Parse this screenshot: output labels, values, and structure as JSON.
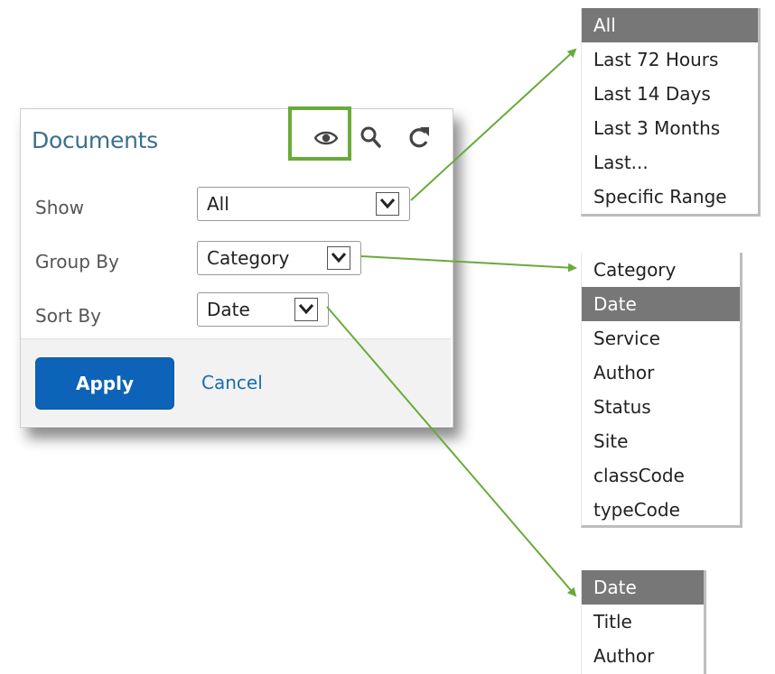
{
  "panel": {
    "title": "Documents",
    "icons": [
      "eye-icon",
      "search-icon",
      "refresh-icon"
    ],
    "highlight_color": "#6aaa3a",
    "show": {
      "label": "Show",
      "value": "All"
    },
    "group_by": {
      "label": "Group By",
      "value": "Category"
    },
    "sort_by": {
      "label": "Sort By",
      "value": "Date"
    },
    "apply_label": "Apply",
    "cancel_label": "Cancel",
    "accent_color": "#0c63b8"
  },
  "show_options": {
    "items": [
      "All",
      "Last 72 Hours",
      "Last 14 Days",
      "Last 3 Months",
      "Last...",
      "Specific Range"
    ],
    "selected": "All"
  },
  "group_by_options": {
    "items": [
      "Category",
      "Date",
      "Service",
      "Author",
      "Status",
      "Site",
      "classCode",
      "typeCode"
    ],
    "selected": "Date"
  },
  "sort_by_options": {
    "items": [
      "Date",
      "Title",
      "Author"
    ],
    "selected": "Date"
  }
}
